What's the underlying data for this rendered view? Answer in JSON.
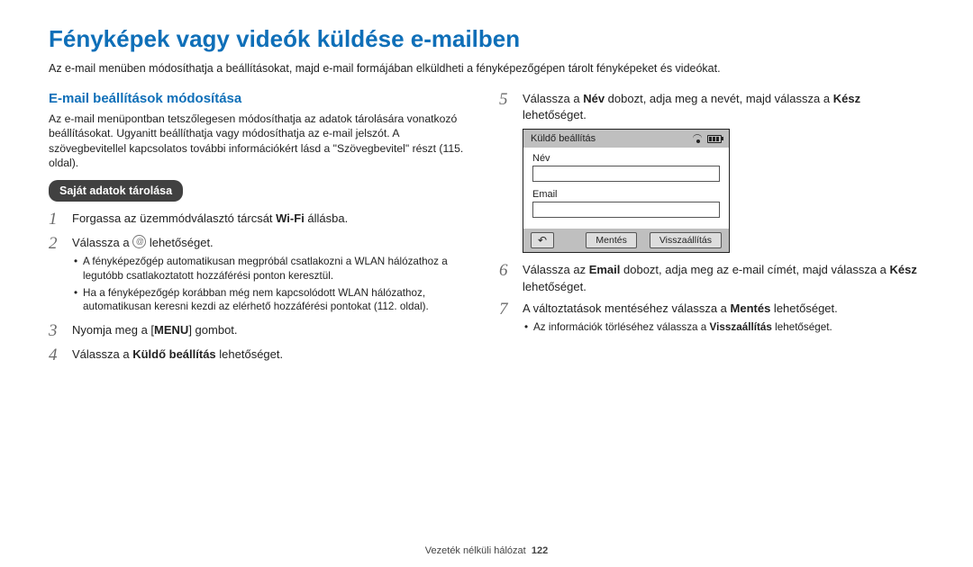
{
  "title": "Fényképek vagy videók küldése e-mailben",
  "intro": "Az e-mail menüben módosíthatja a beállításokat, majd e-mail formájában elküldheti a fényképezőgépen tárolt fényképeket és videókat.",
  "left": {
    "subhead": "E-mail beállítások módosítása",
    "para": "Az e-mail menüpontban tetszőlegesen módosíthatja az adatok tárolására vonatkozó beállításokat. Ugyanitt beállíthatja vagy módosíthatja az e-mail jelszót. A szövegbevitellel kapcsolatos további információkért lásd a \"Szövegbevitel\" részt (115. oldal).",
    "pill": "Saját adatok tárolása",
    "step1_a": "Forgassa az üzemmódválasztó tárcsát ",
    "step1_wifi": "Wi-Fi",
    "step1_b": " állásba.",
    "step2_a": "Válassza a ",
    "step2_b": " lehetőséget.",
    "bullets23": [
      "A fényképezőgép automatikusan megpróbál csatlakozni a WLAN hálózathoz a legutóbb csatlakoztatott hozzáférési ponton keresztül.",
      "Ha a fényképezőgép korábban még nem kapcsolódott WLAN hálózathoz, automatikusan keresni kezdi az elérhető hozzáférési pontokat (112. oldal)."
    ],
    "step3_a": "Nyomja meg a [",
    "step3_menu": "MENU",
    "step3_b": "] gombot.",
    "step4_a": "Válassza a ",
    "step4_bold": "Küldő beállítás",
    "step4_b": " lehetőséget."
  },
  "right": {
    "step5_a": "Válassza a ",
    "step5_bold1": "Név",
    "step5_b": " dobozt, adja meg a nevét, majd válassza a ",
    "step5_bold2": "Kész",
    "step5_c": " lehetőséget.",
    "device": {
      "header": "Küldő beállítás",
      "name_label": "Név",
      "email_label": "Email",
      "save": "Mentés",
      "reset": "Visszaállítás"
    },
    "step6_a": "Válassza az ",
    "step6_bold1": "Email",
    "step6_b": " dobozt, adja meg az e-mail címét, majd válassza a ",
    "step6_bold2": "Kész",
    "step6_c": " lehetőséget.",
    "step7_a": "A változtatások mentéséhez válassza a ",
    "step7_bold": "Mentés",
    "step7_b": " lehetőséget.",
    "bullets7_pre": "Az információk törléséhez válassza a ",
    "bullets7_bold": "Visszaállítás",
    "bullets7_post": " lehetőséget."
  },
  "footer": {
    "section": "Vezeték nélküli hálózat",
    "page": "122"
  }
}
